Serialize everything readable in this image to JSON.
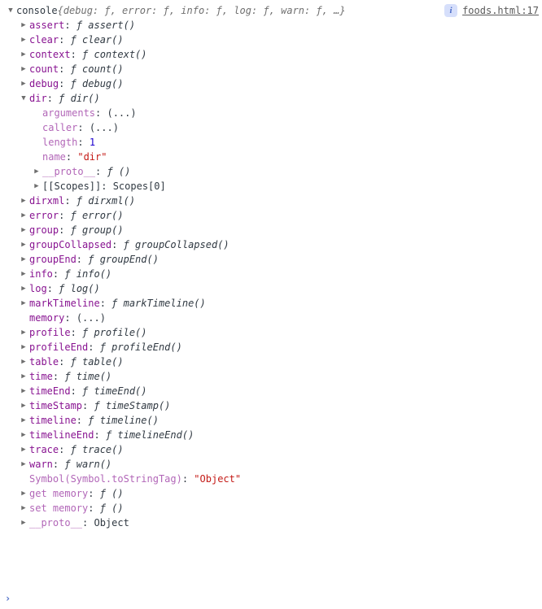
{
  "source_link": "foods.html:17",
  "info_badge": "i",
  "root": {
    "name": "console",
    "preview": "{debug: ƒ, error: ƒ, info: ƒ, log: ƒ, warn: ƒ, …}"
  },
  "props": [
    {
      "arrow": "right",
      "depth": 0,
      "key": "assert",
      "keyStyle": "key",
      "valType": "fn",
      "val": "ƒ assert()"
    },
    {
      "arrow": "right",
      "depth": 0,
      "key": "clear",
      "keyStyle": "key",
      "valType": "fn",
      "val": "ƒ clear()"
    },
    {
      "arrow": "right",
      "depth": 0,
      "key": "context",
      "keyStyle": "key",
      "valType": "fn",
      "val": "ƒ context()"
    },
    {
      "arrow": "right",
      "depth": 0,
      "key": "count",
      "keyStyle": "key",
      "valType": "fn",
      "val": "ƒ count()"
    },
    {
      "arrow": "right",
      "depth": 0,
      "key": "debug",
      "keyStyle": "key",
      "valType": "fn",
      "val": "ƒ debug()"
    },
    {
      "arrow": "down",
      "depth": 0,
      "key": "dir",
      "keyStyle": "key",
      "valType": "fn",
      "val": "ƒ dir()"
    },
    {
      "arrow": "none",
      "depth": 1,
      "key": "arguments",
      "keyStyle": "faded",
      "valType": "ph",
      "val": "(...)"
    },
    {
      "arrow": "none",
      "depth": 1,
      "key": "caller",
      "keyStyle": "faded",
      "valType": "ph",
      "val": "(...)"
    },
    {
      "arrow": "none",
      "depth": 1,
      "key": "length",
      "keyStyle": "faded",
      "valType": "num",
      "val": "1"
    },
    {
      "arrow": "none",
      "depth": 1,
      "key": "name",
      "keyStyle": "faded",
      "valType": "str",
      "val": "\"dir\""
    },
    {
      "arrow": "right",
      "depth": 1,
      "key": "__proto__",
      "keyStyle": "faded",
      "valType": "fn",
      "val": "ƒ ()"
    },
    {
      "arrow": "right",
      "depth": 1,
      "key": "[[Scopes]]",
      "keyStyle": "internal",
      "valType": "obj",
      "val": "Scopes[0]"
    },
    {
      "arrow": "right",
      "depth": 0,
      "key": "dirxml",
      "keyStyle": "key",
      "valType": "fn",
      "val": "ƒ dirxml()"
    },
    {
      "arrow": "right",
      "depth": 0,
      "key": "error",
      "keyStyle": "key",
      "valType": "fn",
      "val": "ƒ error()"
    },
    {
      "arrow": "right",
      "depth": 0,
      "key": "group",
      "keyStyle": "key",
      "valType": "fn",
      "val": "ƒ group()"
    },
    {
      "arrow": "right",
      "depth": 0,
      "key": "groupCollapsed",
      "keyStyle": "key",
      "valType": "fn",
      "val": "ƒ groupCollapsed()"
    },
    {
      "arrow": "right",
      "depth": 0,
      "key": "groupEnd",
      "keyStyle": "key",
      "valType": "fn",
      "val": "ƒ groupEnd()"
    },
    {
      "arrow": "right",
      "depth": 0,
      "key": "info",
      "keyStyle": "key",
      "valType": "fn",
      "val": "ƒ info()"
    },
    {
      "arrow": "right",
      "depth": 0,
      "key": "log",
      "keyStyle": "key",
      "valType": "fn",
      "val": "ƒ log()"
    },
    {
      "arrow": "right",
      "depth": 0,
      "key": "markTimeline",
      "keyStyle": "key",
      "valType": "fn",
      "val": "ƒ markTimeline()"
    },
    {
      "arrow": "none",
      "depth": 0,
      "key": "memory",
      "keyStyle": "key",
      "valType": "ph",
      "val": "(...)"
    },
    {
      "arrow": "right",
      "depth": 0,
      "key": "profile",
      "keyStyle": "key",
      "valType": "fn",
      "val": "ƒ profile()"
    },
    {
      "arrow": "right",
      "depth": 0,
      "key": "profileEnd",
      "keyStyle": "key",
      "valType": "fn",
      "val": "ƒ profileEnd()"
    },
    {
      "arrow": "right",
      "depth": 0,
      "key": "table",
      "keyStyle": "key",
      "valType": "fn",
      "val": "ƒ table()"
    },
    {
      "arrow": "right",
      "depth": 0,
      "key": "time",
      "keyStyle": "key",
      "valType": "fn",
      "val": "ƒ time()"
    },
    {
      "arrow": "right",
      "depth": 0,
      "key": "timeEnd",
      "keyStyle": "key",
      "valType": "fn",
      "val": "ƒ timeEnd()"
    },
    {
      "arrow": "right",
      "depth": 0,
      "key": "timeStamp",
      "keyStyle": "key",
      "valType": "fn",
      "val": "ƒ timeStamp()"
    },
    {
      "arrow": "right",
      "depth": 0,
      "key": "timeline",
      "keyStyle": "key",
      "valType": "fn",
      "val": "ƒ timeline()"
    },
    {
      "arrow": "right",
      "depth": 0,
      "key": "timelineEnd",
      "keyStyle": "key",
      "valType": "fn",
      "val": "ƒ timelineEnd()"
    },
    {
      "arrow": "right",
      "depth": 0,
      "key": "trace",
      "keyStyle": "key",
      "valType": "fn",
      "val": "ƒ trace()"
    },
    {
      "arrow": "right",
      "depth": 0,
      "key": "warn",
      "keyStyle": "key",
      "valType": "fn",
      "val": "ƒ warn()"
    },
    {
      "arrow": "none",
      "depth": 0,
      "key": "Symbol(Symbol.toStringTag)",
      "keyStyle": "faded",
      "valType": "str",
      "val": "\"Object\""
    },
    {
      "arrow": "right",
      "depth": 0,
      "key": "get memory",
      "keyStyle": "faded",
      "valType": "fn",
      "val": "ƒ ()"
    },
    {
      "arrow": "right",
      "depth": 0,
      "key": "set memory",
      "keyStyle": "faded",
      "valType": "fn",
      "val": "ƒ ()"
    },
    {
      "arrow": "right",
      "depth": 0,
      "key": "__proto__",
      "keyStyle": "faded",
      "valType": "obj",
      "val": "Object"
    }
  ],
  "prompt": "›"
}
